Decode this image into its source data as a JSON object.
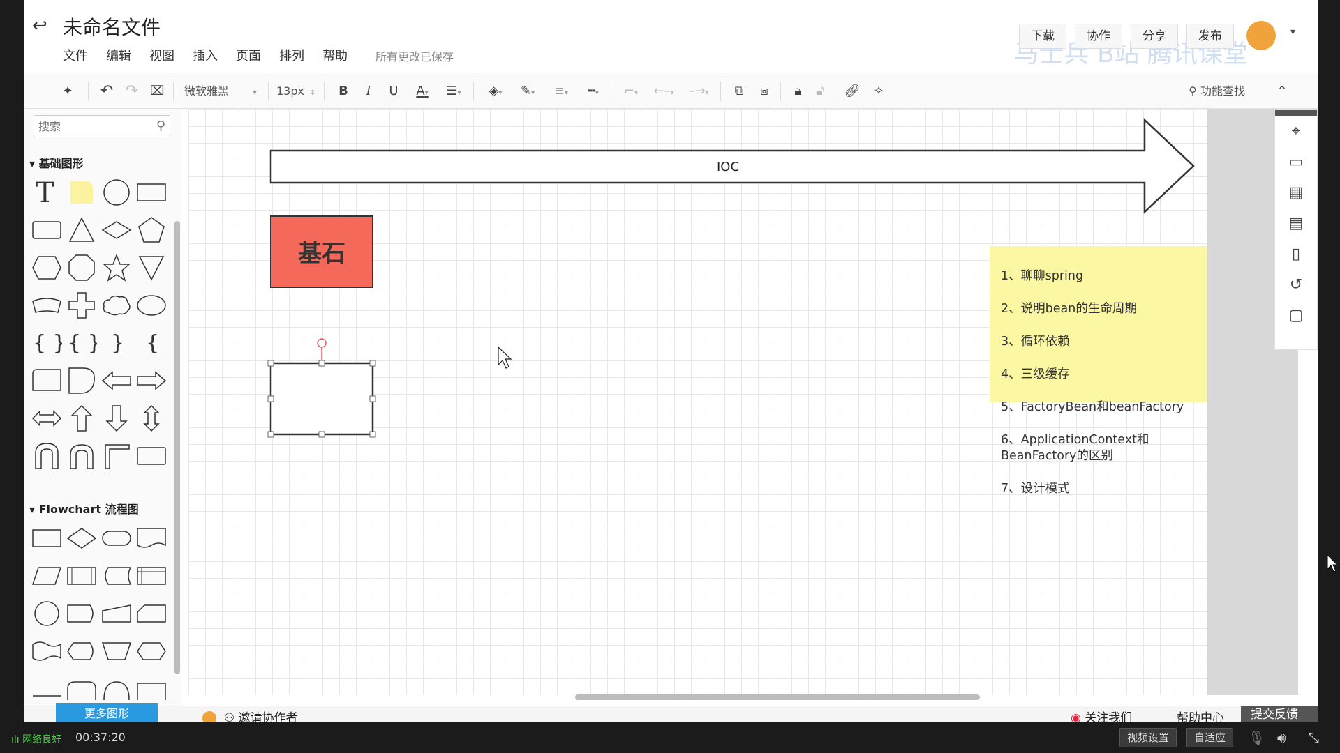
{
  "title": "未命名文件",
  "menu": [
    "文件",
    "编辑",
    "视图",
    "插入",
    "页面",
    "排列",
    "帮助"
  ],
  "save_status": "所有更改已保存",
  "top_buttons": {
    "download": "下载",
    "collaborate": "协作",
    "share": "分享",
    "publish": "发布"
  },
  "watermark": "马士兵 B站 腾讯课堂",
  "toolbar": {
    "font": "微软雅黑",
    "size": "13px",
    "bold": "B",
    "italic": "I",
    "underline": "U",
    "font_color": "A",
    "find": "功能查找"
  },
  "left_panel": {
    "search_placeholder": "搜索",
    "section_basic": "基础图形",
    "section_flowchart": "Flowchart 流程图",
    "more_shapes": "更多图形"
  },
  "diagram": {
    "arrow_label": "IOC",
    "box_label": "基石",
    "box_color": "#f5695a",
    "note_color": "#fbf7a2",
    "note_lines": [
      "1、聊聊spring",
      "2、说明bean的生命周期",
      "3、循环依赖",
      "4、三级缓存",
      "5、FactoryBean和beanFactory",
      "6、ApplicationContext和\nBeanFactory的区别",
      "7、设计模式"
    ]
  },
  "bottom_bar": {
    "invite": "邀请协作者",
    "follow": "关注我们",
    "help": "帮助中心",
    "feedback": "提交反馈"
  },
  "video_footer": {
    "network": "网络良好",
    "time": "00:37:20",
    "settings": "视频设置",
    "adaptive": "自适应"
  },
  "colors": {
    "accent": "#2a9ae0",
    "feedback_bg": "#555555"
  }
}
